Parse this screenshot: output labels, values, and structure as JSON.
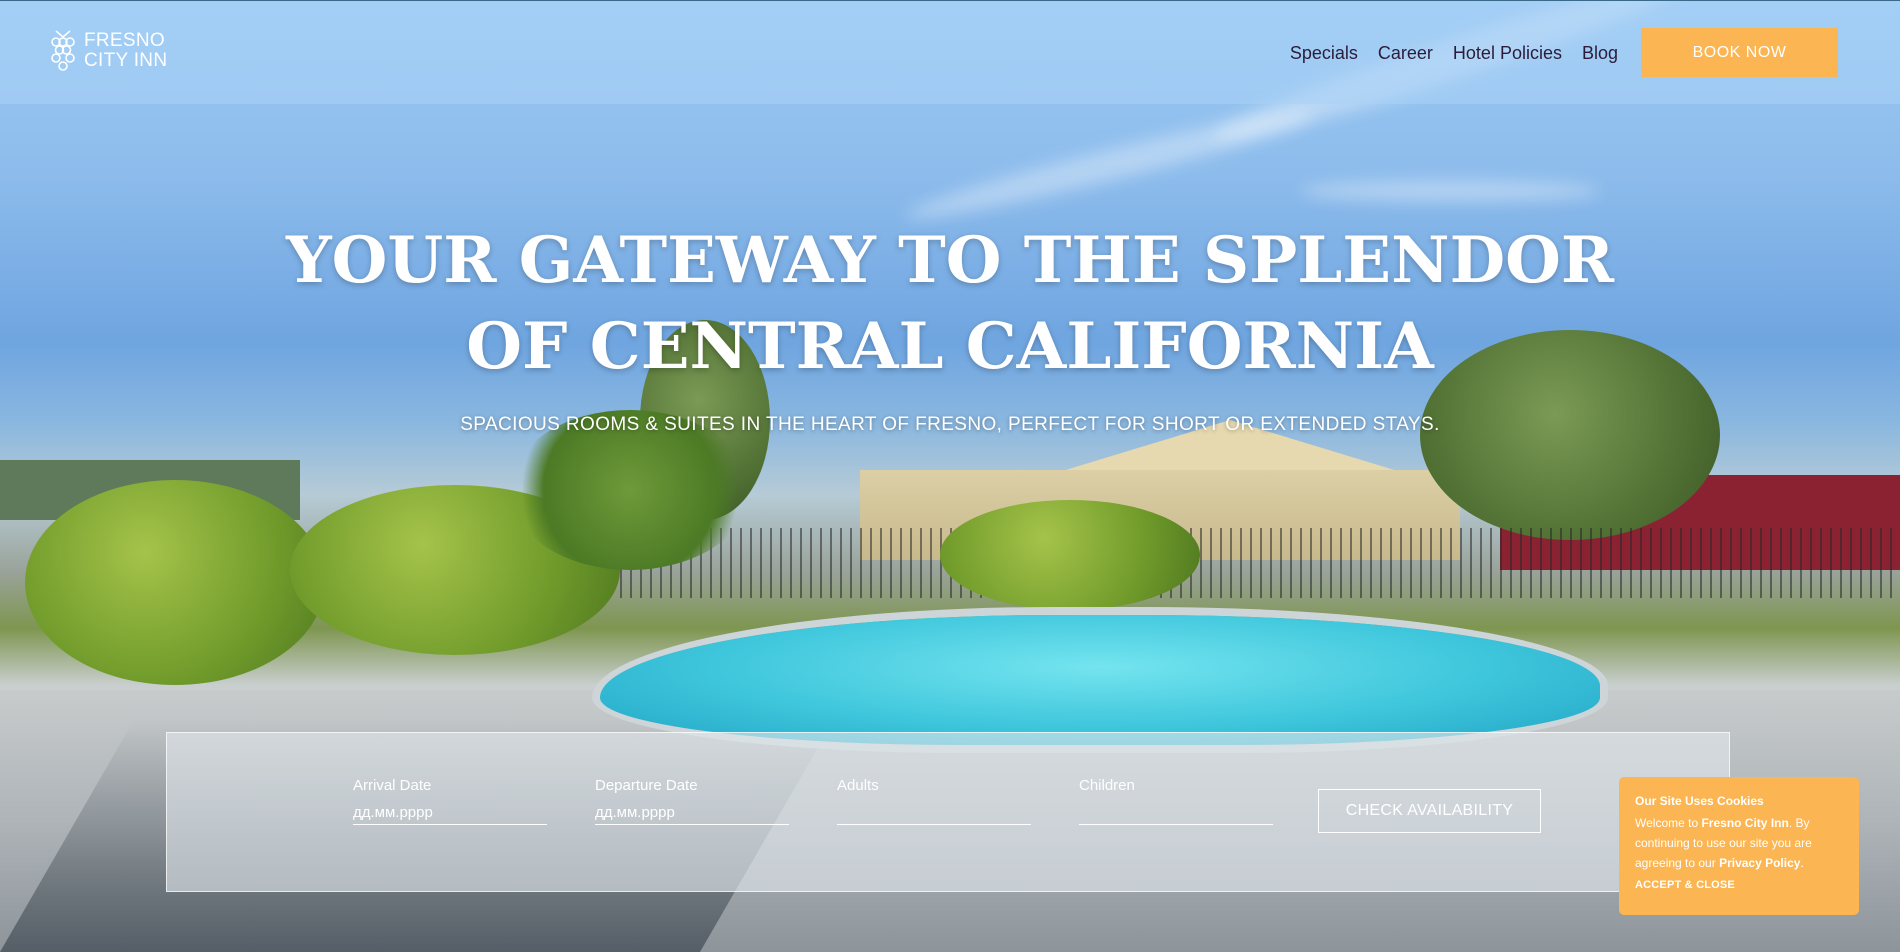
{
  "brand": {
    "line1": "FRESNO",
    "line2": "CITY INN"
  },
  "nav": [
    {
      "label": "Specials"
    },
    {
      "label": "Career"
    },
    {
      "label": "Hotel Policies"
    },
    {
      "label": "Blog"
    }
  ],
  "header": {
    "book_now_label": "BOOK NOW"
  },
  "hero": {
    "headline_line1": "YOUR GATEWAY TO THE SPLENDOR",
    "headline_line2": "OF CENTRAL CALIFORNIA",
    "subheadline": "SPACIOUS ROOMS & SUITES IN THE HEART OF FRESNO, PERFECT FOR SHORT OR EXTENDED STAYS."
  },
  "booking": {
    "arrival_label": "Arrival Date",
    "arrival_placeholder": "дд.мм.рррр",
    "departure_label": "Departure Date",
    "departure_placeholder": "дд.мм.рррр",
    "adults_label": "Adults",
    "adults_value": "",
    "children_label": "Children",
    "children_value": "",
    "check_label": "CHECK AVAILABILITY"
  },
  "cookie": {
    "title": "Our Site Uses Cookies",
    "welcome": "Welcome to ",
    "brand_name": "Fresno City Inn",
    "body": ". By continuing to use our site you are agreeing to our ",
    "policy_link": "Privacy Policy",
    "end": ".",
    "accept_label": "ACCEPT & CLOSE"
  },
  "colors": {
    "accent": "#fbb552",
    "nav_text": "#2b1d3a",
    "pool": "#3ec6dc"
  },
  "icons": {
    "logo": "grape-cluster-icon"
  }
}
